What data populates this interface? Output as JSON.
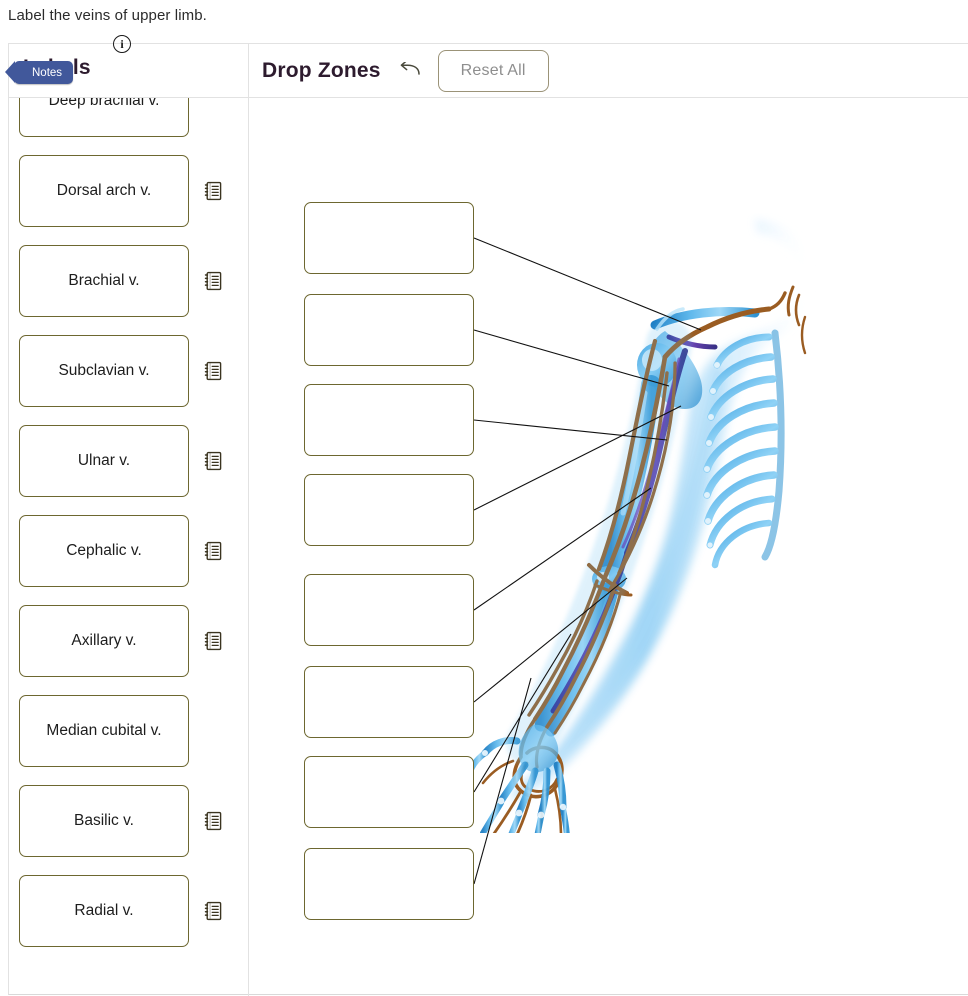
{
  "question": {
    "prompt": "Label the veins of upper limb."
  },
  "labels_panel": {
    "title": "Labels",
    "notes_badge": "Notes",
    "info_icon": "info-icon",
    "info_glyph": "i",
    "items": [
      {
        "label": "Deep brachial v.",
        "has_note": false
      },
      {
        "label": "Dorsal arch v.",
        "has_note": true
      },
      {
        "label": "Brachial v.",
        "has_note": true
      },
      {
        "label": "Subclavian v.",
        "has_note": true
      },
      {
        "label": "Ulnar v.",
        "has_note": true
      },
      {
        "label": "Cephalic v.",
        "has_note": true
      },
      {
        "label": "Axillary v.",
        "has_note": true
      },
      {
        "label": "Median cubital v.",
        "has_note": false
      },
      {
        "label": "Basilic v.",
        "has_note": true
      },
      {
        "label": "Radial v.",
        "has_note": true
      }
    ]
  },
  "dropzones_panel": {
    "title": "Drop Zones",
    "undo_icon": "undo-arrow-icon",
    "reset_label": "Reset All",
    "zones": [
      {
        "index": 1,
        "value": ""
      },
      {
        "index": 2,
        "value": ""
      },
      {
        "index": 3,
        "value": ""
      },
      {
        "index": 4,
        "value": ""
      },
      {
        "index": 5,
        "value": ""
      },
      {
        "index": 6,
        "value": ""
      },
      {
        "index": 7,
        "value": ""
      },
      {
        "index": 8,
        "value": ""
      }
    ]
  },
  "figure": {
    "name": "upper-limb-veins-illustration",
    "alt": "Anterior view of right upper limb showing veins, arteries and skeleton"
  },
  "colors": {
    "card_border": "#6d6730",
    "title": "#2d1b2e",
    "notes_badge_bg": "#41589b",
    "reset_border": "#9b9378",
    "reset_text": "#8e8e8e",
    "panel_divider": "#e2e2e2",
    "leader_line": "#111111",
    "vessel_artery": "#9a5c22",
    "bone_blue": "#3aa0e0"
  }
}
